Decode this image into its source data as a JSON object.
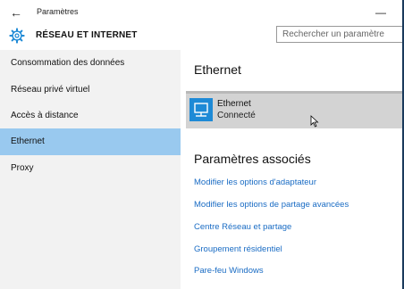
{
  "window": {
    "title": "Paramètres",
    "back_glyph": "←",
    "minimize_glyph": "—"
  },
  "header": {
    "section_title": "RÉSEAU ET INTERNET",
    "search_placeholder": "Rechercher un paramètre"
  },
  "sidebar": {
    "items": [
      {
        "label": "Consommation des données",
        "selected": false
      },
      {
        "label": "Réseau privé virtuel",
        "selected": false
      },
      {
        "label": "Accès à distance",
        "selected": false
      },
      {
        "label": "Ethernet",
        "selected": true
      },
      {
        "label": "Proxy",
        "selected": false
      }
    ]
  },
  "main": {
    "heading": "Ethernet",
    "connection": {
      "name": "Ethernet",
      "status": "Connecté",
      "icon": "network-adapter-icon"
    },
    "related_heading": "Paramètres associés",
    "links": [
      "Modifier les options d'adaptateur",
      "Modifier les options de partage avancées",
      "Centre Réseau et partage",
      "Groupement résidentiel",
      "Pare-feu Windows"
    ]
  },
  "colors": {
    "accent": "#1e8ad6",
    "selected_nav": "#99c9ef",
    "link": "#1a6cc4",
    "sidebar_bg": "#f2f2f2",
    "row_bg": "#d3d3d3"
  }
}
